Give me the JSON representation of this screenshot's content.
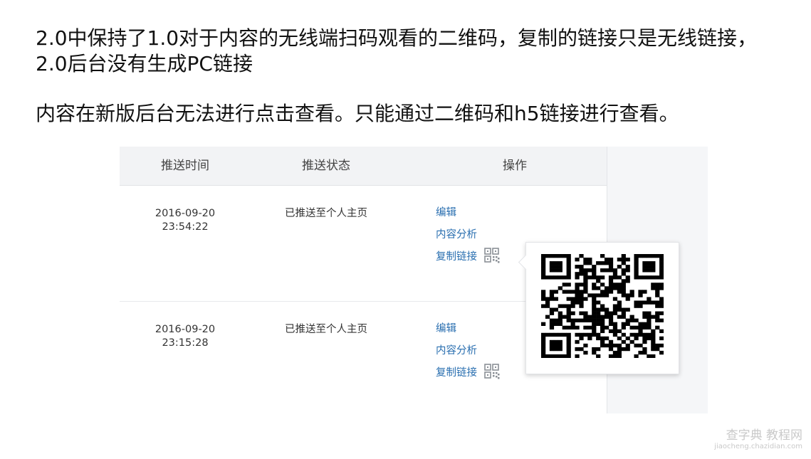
{
  "paragraphs": {
    "first": "2.0中保持了1.0对于内容的无线端扫码观看的二维码，复制的链接只是无线链接，2.0后台没有生成PC链接",
    "second": "内容在新版后台无法进行点击查看。只能通过二维码和h5链接进行查看。"
  },
  "table": {
    "headers": [
      "推送时间",
      "推送状态",
      "操作"
    ],
    "rows": [
      {
        "date": "2016-09-20",
        "time": "23:54:22",
        "status": "已推送至个人主页",
        "actions": {
          "edit": "编辑",
          "analysis": "内容分析",
          "copy_link": "复制链接"
        }
      },
      {
        "date": "2016-09-20",
        "time": "23:15:28",
        "status": "已推送至个人主页",
        "actions": {
          "edit": "编辑",
          "analysis": "内容分析",
          "copy_link": "复制链接"
        }
      }
    ]
  },
  "popup": {
    "icon": "qr-code-image"
  },
  "icons": {
    "qr_button": "qr-code-icon"
  },
  "colors": {
    "link": "#2a6fb0",
    "header_bg": "#f2f3f5"
  },
  "watermark": {
    "main": "查字典 教程网",
    "sub": "jiaocheng.chazidian.com"
  }
}
